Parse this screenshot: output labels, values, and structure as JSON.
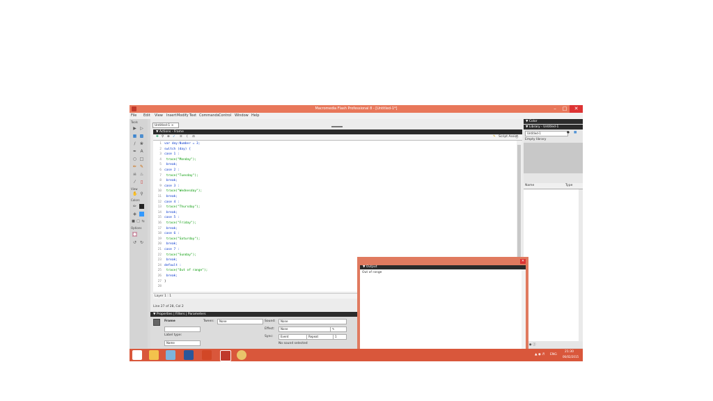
{
  "window": {
    "title": "Macromedia Flash Professional 8 - [Untitled-1*]",
    "minimize": "–",
    "maximize": "□",
    "close": "✕"
  },
  "menu": [
    "File",
    "Edit",
    "View",
    "Insert",
    "Modify",
    "Text",
    "Commands",
    "Control",
    "Window",
    "Help"
  ],
  "tools": {
    "label_tools": "Tools",
    "label_view": "View",
    "label_colors": "Colors",
    "label_options": "Options"
  },
  "document": {
    "tab": "Untitled-1 ×",
    "panel_title": "▼ Actions - Frame",
    "script_assist": "Script Assist"
  },
  "code": [
    {
      "n": "1",
      "t": "var day:Number = 3;"
    },
    {
      "n": "2",
      "t": "switch (day) {"
    },
    {
      "n": "3",
      "t": "case 1 :"
    },
    {
      "n": "4",
      "t": "    trace(\"Monday\");"
    },
    {
      "n": "5",
      "t": "    break;"
    },
    {
      "n": "6",
      "t": "case 2 :"
    },
    {
      "n": "7",
      "t": "    trace(\"Tuesday\");"
    },
    {
      "n": "8",
      "t": "    break;"
    },
    {
      "n": "9",
      "t": "case 3 :"
    },
    {
      "n": "10",
      "t": "    trace(\"Wednesday\");"
    },
    {
      "n": "11",
      "t": "    break;"
    },
    {
      "n": "12",
      "t": "case 4 :"
    },
    {
      "n": "13",
      "t": "    trace(\"Thursday\");"
    },
    {
      "n": "14",
      "t": "    break;"
    },
    {
      "n": "15",
      "t": "case 5 :"
    },
    {
      "n": "16",
      "t": "    trace(\"Friday\");"
    },
    {
      "n": "17",
      "t": "    break;"
    },
    {
      "n": "18",
      "t": "case 6 :"
    },
    {
      "n": "19",
      "t": "    trace(\"Saturday\");"
    },
    {
      "n": "20",
      "t": "    break;"
    },
    {
      "n": "21",
      "t": "case 7 :"
    },
    {
      "n": "22",
      "t": "    trace(\"Sunday\");"
    },
    {
      "n": "23",
      "t": "    break;"
    },
    {
      "n": "24",
      "t": "default :"
    },
    {
      "n": "25",
      "t": "    trace(\"Out of range\");"
    },
    {
      "n": "26",
      "t": "    break;"
    },
    {
      "n": "27",
      "t": "}"
    },
    {
      "n": "28",
      "t": ""
    }
  ],
  "editor_status": {
    "layer": "Layer 1 : 1",
    "position": "Line 27 of 28, Col 2"
  },
  "output": {
    "title": "▼ Output",
    "text": "Out of range"
  },
  "properties": {
    "tabs": "▼ Properties | Filters | Parameters",
    "frame": "Frame",
    "tween": "Tween:",
    "tween_value": "None",
    "sound": "Sound:",
    "sound_value": "None",
    "effect": "Effect:",
    "effect_value": "None",
    "sync": "Sync:",
    "sync_value": "Event",
    "repeat": "Repeat",
    "no_sound": "No sound selected",
    "label_type": "Label type:",
    "label_value": "Name"
  },
  "right_panel": {
    "hdr1": "▼ Color",
    "hdr2": "▼ Library - Untitled-1",
    "lib_doc": "Untitled-1",
    "lib_empty": "Empty library",
    "col_name": "Name",
    "col_type": "Type"
  },
  "taskbar": {
    "time": "21:30",
    "lang": "ENG",
    "date": "06/02/2015"
  }
}
